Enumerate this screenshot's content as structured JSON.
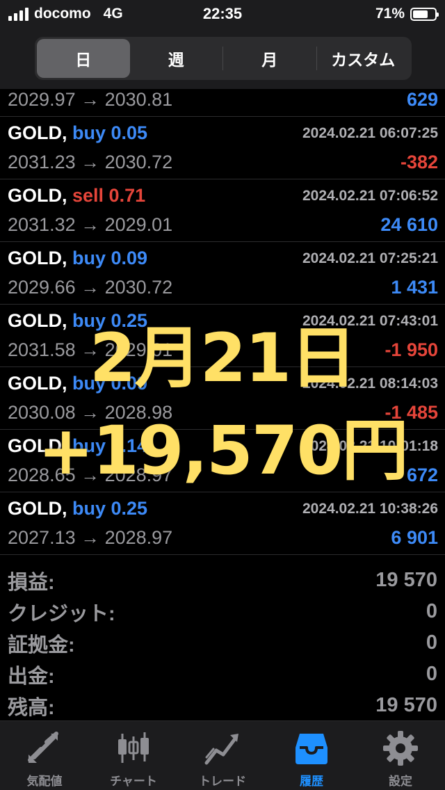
{
  "status": {
    "carrier": "docomo",
    "network": "4G",
    "time": "22:35",
    "battery": "71%",
    "battery_level": 0.71
  },
  "segments": [
    {
      "label": "日",
      "active": true
    },
    {
      "label": "週",
      "active": false
    },
    {
      "label": "月",
      "active": false
    },
    {
      "label": "カスタム",
      "active": false
    }
  ],
  "partial_row": {
    "prices": "2029.97 → 2030.81",
    "profit": "629",
    "profit_sign": "pos"
  },
  "trades": [
    {
      "symbol": "GOLD,",
      "side": "buy",
      "volume": "buy 0.05",
      "time": "2024.02.21 06:07:25",
      "prices": "2031.23 → 2030.72",
      "profit": "-382",
      "profit_sign": "neg"
    },
    {
      "symbol": "GOLD,",
      "side": "sell",
      "volume": "sell 0.71",
      "time": "2024.02.21 07:06:52",
      "prices": "2031.32 → 2029.01",
      "profit": "24 610",
      "profit_sign": "pos"
    },
    {
      "symbol": "GOLD,",
      "side": "buy",
      "volume": "buy 0.09",
      "time": "2024.02.21 07:25:21",
      "prices": "2029.66 → 2030.72",
      "profit": "1 431",
      "profit_sign": "pos"
    },
    {
      "symbol": "GOLD,",
      "side": "buy",
      "volume": "buy 0.25",
      "time": "2024.02.21 07:43:01",
      "prices": "2031.58 → 2029.01",
      "profit": "-1 950",
      "profit_sign": "neg"
    },
    {
      "symbol": "GOLD,",
      "side": "buy",
      "volume": "buy 0.09",
      "time": "2024.02.21 08:14:03",
      "prices": "2030.08 → 2028.98",
      "profit": "-1 485",
      "profit_sign": "neg"
    },
    {
      "symbol": "GOLD,",
      "side": "buy",
      "volume": "buy 0.14",
      "time": "2024.02.21 10:01:18",
      "prices": "2028.65 → 2028.97",
      "profit": "672",
      "profit_sign": "pos"
    },
    {
      "symbol": "GOLD,",
      "side": "buy",
      "volume": "buy 0.25",
      "time": "2024.02.21 10:38:26",
      "prices": "2027.13 → 2028.97",
      "profit": "6 901",
      "profit_sign": "pos"
    }
  ],
  "summary": [
    {
      "label": "損益:",
      "value": "19 570"
    },
    {
      "label": "クレジット:",
      "value": "0"
    },
    {
      "label": "証拠金:",
      "value": "0"
    },
    {
      "label": "出金:",
      "value": "0"
    },
    {
      "label": "残高:",
      "value": "19 570"
    }
  ],
  "tabs": [
    {
      "label": "気配値",
      "icon": "quotes-icon",
      "active": false
    },
    {
      "label": "チャート",
      "icon": "candlestick-icon",
      "active": false
    },
    {
      "label": "トレード",
      "icon": "trade-icon",
      "active": false
    },
    {
      "label": "履歴",
      "icon": "history-tray-icon",
      "active": true
    },
    {
      "label": "設定",
      "icon": "gear-icon",
      "active": false
    }
  ],
  "overlay": {
    "date": "2月21日",
    "amount": "+19,570円"
  },
  "colors": {
    "buy": "#3d8af7",
    "sell": "#e5453a",
    "accent": "#1e90ff",
    "overlay": "#ffe066"
  }
}
